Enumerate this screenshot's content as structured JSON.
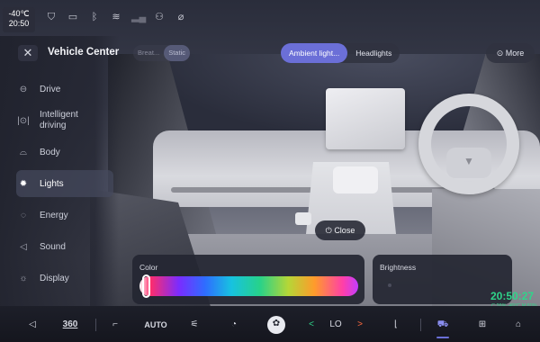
{
  "status_bar": {
    "temperature": "-40℃",
    "time": "20:50",
    "icons": [
      "shield-icon",
      "battery-outline-icon",
      "bluetooth-icon",
      "wifi-icon",
      "signal-icon",
      "user-icon",
      "location-off-icon"
    ]
  },
  "header": {
    "title": "Vehicle Center",
    "left_tabs": [
      {
        "label": "Breat...",
        "active": false
      },
      {
        "label": "Static",
        "active": true
      }
    ],
    "center_tabs": [
      {
        "label": "Ambient light...",
        "active": true
      },
      {
        "label": "Headlights",
        "active": false
      }
    ],
    "more_label": "More"
  },
  "sidebar": {
    "items": [
      {
        "label": "Drive",
        "icon": "steering-icon",
        "active": false
      },
      {
        "label": "Intelligent driving",
        "icon": "intelligent-driving-icon",
        "active": false
      },
      {
        "label": "Body",
        "icon": "car-body-icon",
        "active": false
      },
      {
        "label": "Lights",
        "icon": "light-bulb-icon",
        "active": true
      },
      {
        "label": "Energy",
        "icon": "energy-icon",
        "active": false
      },
      {
        "label": "Sound",
        "icon": "speaker-icon",
        "active": false
      },
      {
        "label": "Display",
        "icon": "display-icon",
        "active": false
      }
    ]
  },
  "scene": {
    "close_label": "Close"
  },
  "color_panel": {
    "label": "Color",
    "accent_colors": [
      "#ffffff",
      "#ff2d6b",
      "#7a2cff",
      "#2e6dff",
      "#17c2e0",
      "#27d28a",
      "#b5d637",
      "#ff9b2b",
      "#ff3fa8",
      "#c23cff"
    ]
  },
  "brightness_panel": {
    "label": "Brightness"
  },
  "clock": {
    "time": "20:50:27",
    "sub": "C:26% -49°C  M:60%"
  },
  "bottom_bar": {
    "items": [
      {
        "name": "volume-icon",
        "label": "◁"
      },
      {
        "name": "360-view-button",
        "label": "360"
      },
      {
        "name": "seat-heat-icon",
        "label": "⌐"
      },
      {
        "name": "auto-ac-button",
        "label": "AUTO"
      },
      {
        "name": "defrost-icon",
        "label": "⚟"
      },
      {
        "name": "car-recirculation-icon",
        "label": "◔"
      },
      {
        "name": "fan-icon",
        "label": "✿"
      },
      {
        "name": "temp-down-button",
        "label": "<"
      },
      {
        "name": "temp-value",
        "label": "LO"
      },
      {
        "name": "temp-up-button",
        "label": ">"
      },
      {
        "name": "seat-icon",
        "label": "⌊"
      },
      {
        "name": "car-icon",
        "label": "⛟"
      },
      {
        "name": "apps-grid-icon",
        "label": "⊞"
      },
      {
        "name": "home-icon",
        "label": "⌂"
      }
    ]
  },
  "colors": {
    "accent": "#6b6fd7",
    "clock_green": "#2fd48a",
    "temp_up_orange": "#ff6a3d"
  }
}
